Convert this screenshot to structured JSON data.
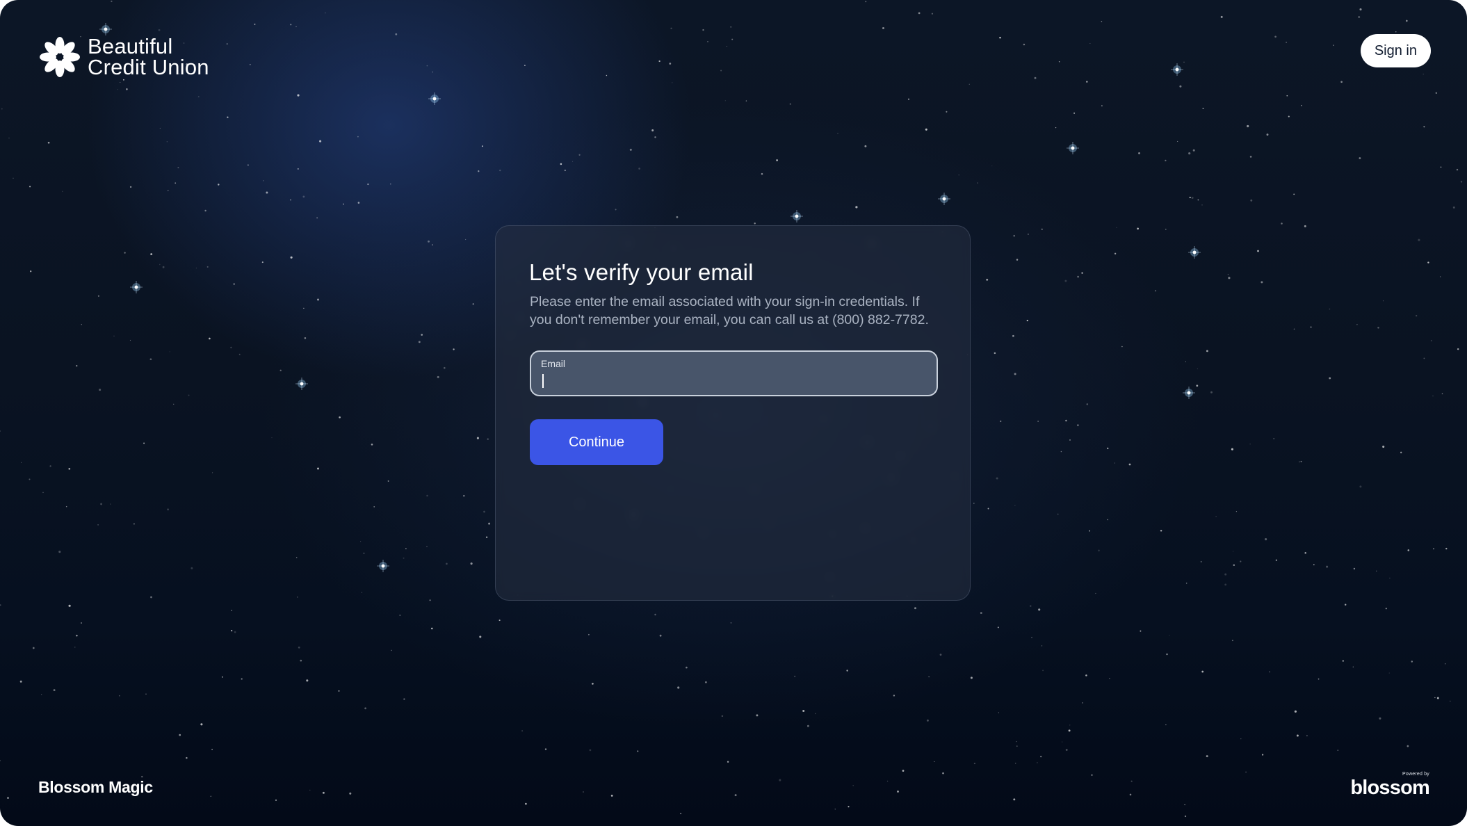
{
  "brand": {
    "logo_icon": "flower-icon",
    "name_line1": "Beautiful",
    "name_line2": "Credit Union"
  },
  "header": {
    "signin_label": "Sign in"
  },
  "verify_card": {
    "title": "Let's verify your email",
    "description": "Please enter the email associated with your sign-in credentials. If you don't remember your email, you can call us at (800) 882-7782.",
    "email_field": {
      "label": "Email",
      "value": ""
    },
    "continue_label": "Continue"
  },
  "footer": {
    "left_text": "Blossom Magic",
    "powered_by": "Powered by",
    "right_logo": "blossom"
  },
  "colors": {
    "background": "#0a1322",
    "card": "#263042",
    "input_fill": "#48556a",
    "primary_button": "#3b55e6",
    "text_primary": "#ffffff",
    "text_secondary": "#aab3c2"
  }
}
